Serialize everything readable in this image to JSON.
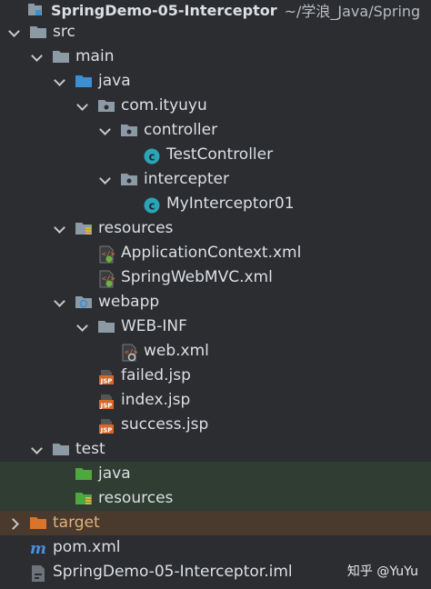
{
  "header": {
    "title": "SpringDemo-05-Interceptor",
    "path": "~/学浪_Java/Spring"
  },
  "tree": [
    {
      "label": "src",
      "depth": 1,
      "expander": "down",
      "icon": "folder-icon"
    },
    {
      "label": "main",
      "depth": 2,
      "expander": "down",
      "icon": "folder-icon"
    },
    {
      "label": "java",
      "depth": 3,
      "expander": "down",
      "icon": "source-folder-icon"
    },
    {
      "label": "com.ityuyu",
      "depth": 4,
      "expander": "down",
      "icon": "package-icon"
    },
    {
      "label": "controller",
      "depth": 5,
      "expander": "down",
      "icon": "package-icon"
    },
    {
      "label": "TestController",
      "depth": 6,
      "expander": "none",
      "icon": "class-icon"
    },
    {
      "label": "intercepter",
      "depth": 5,
      "expander": "down",
      "icon": "package-icon"
    },
    {
      "label": "MyInterceptor01",
      "depth": 6,
      "expander": "none",
      "icon": "class-icon"
    },
    {
      "label": "resources",
      "depth": 3,
      "expander": "down",
      "icon": "resources-folder-icon"
    },
    {
      "label": "ApplicationContext.xml",
      "depth": 4,
      "expander": "none",
      "icon": "spring-xml-icon"
    },
    {
      "label": "SpringWebMVC.xml",
      "depth": 4,
      "expander": "none",
      "icon": "spring-xml-icon"
    },
    {
      "label": "webapp",
      "depth": 3,
      "expander": "down",
      "icon": "web-folder-icon"
    },
    {
      "label": "WEB-INF",
      "depth": 4,
      "expander": "down",
      "icon": "folder-icon"
    },
    {
      "label": "web.xml",
      "depth": 5,
      "expander": "none",
      "icon": "web-xml-icon"
    },
    {
      "label": "failed.jsp",
      "depth": 4,
      "expander": "none",
      "icon": "jsp-icon"
    },
    {
      "label": "index.jsp",
      "depth": 4,
      "expander": "none",
      "icon": "jsp-icon"
    },
    {
      "label": "success.jsp",
      "depth": 4,
      "expander": "none",
      "icon": "jsp-icon"
    },
    {
      "label": "test",
      "depth": 2,
      "expander": "down",
      "icon": "folder-icon"
    },
    {
      "label": "java",
      "depth": 3,
      "expander": "none",
      "icon": "test-source-folder-icon",
      "highlight": "green"
    },
    {
      "label": "resources",
      "depth": 3,
      "expander": "none",
      "icon": "test-resources-folder-icon",
      "highlight": "green"
    },
    {
      "label": "target",
      "depth": 1,
      "expander": "right",
      "icon": "excluded-folder-icon",
      "highlight": "orange"
    },
    {
      "label": "pom.xml",
      "depth": 1,
      "expander": "none",
      "icon": "maven-icon"
    },
    {
      "label": "SpringDemo-05-Interceptor.iml",
      "depth": 1,
      "expander": "none",
      "icon": "iml-file-icon"
    }
  ],
  "watermark": "知乎 @YuYu",
  "colors": {
    "background": "#2b2d30",
    "text": "#dcdfe4",
    "folder": "#8c9aa6",
    "source_folder": "#3d8fd1",
    "test_folder": "#4fa83d",
    "excluded_folder": "#d8742c",
    "class": "#2aa4b7",
    "jsp": "#d6682e",
    "maven": "#4a8fe0"
  }
}
